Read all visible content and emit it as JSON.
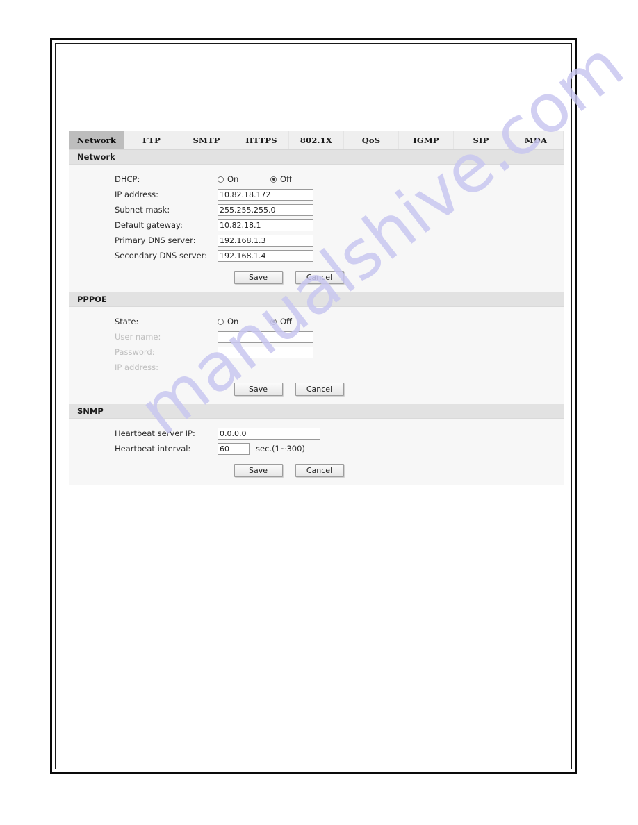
{
  "watermark": {
    "text": "manualshive.com",
    "color": "#c9c7f0"
  },
  "tabs": [
    {
      "label": "Network",
      "active": true
    },
    {
      "label": "FTP",
      "active": false
    },
    {
      "label": "SMTP",
      "active": false
    },
    {
      "label": "HTTPS",
      "active": false
    },
    {
      "label": "802.1X",
      "active": false
    },
    {
      "label": "QoS",
      "active": false
    },
    {
      "label": "IGMP",
      "active": false
    },
    {
      "label": "SIP",
      "active": false
    },
    {
      "label": "MDA",
      "active": false
    }
  ],
  "network": {
    "section_title": "Network",
    "dhcp": {
      "label": "DHCP:",
      "on_label": "On",
      "off_label": "Off",
      "selected": "Off"
    },
    "fields": [
      {
        "label": "IP address:",
        "value": "10.82.18.172"
      },
      {
        "label": "Subnet mask:",
        "value": "255.255.255.0"
      },
      {
        "label": "Default gateway:",
        "value": "10.82.18.1"
      },
      {
        "label": "Primary DNS server:",
        "value": "192.168.1.3"
      },
      {
        "label": "Secondary DNS server:",
        "value": "192.168.1.4"
      }
    ],
    "save_label": "Save",
    "cancel_label": "Cancel"
  },
  "pppoe": {
    "section_title": "PPPOE",
    "state": {
      "label": "State:",
      "on_label": "On",
      "off_label": "Off",
      "selected": "Off"
    },
    "username": {
      "label": "User name:",
      "value": "",
      "disabled": true
    },
    "password": {
      "label": "Password:",
      "value": "",
      "disabled": true
    },
    "ip_address": {
      "label": "IP address:",
      "value": "",
      "disabled": true
    },
    "save_label": "Save",
    "cancel_label": "Cancel"
  },
  "snmp": {
    "section_title": "SNMP",
    "heartbeat_server_ip": {
      "label": "Heartbeat server IP:",
      "value": "0.0.0.0"
    },
    "heartbeat_interval": {
      "label": "Heartbeat interval:",
      "value": "60",
      "suffix": "sec.(1~300)"
    },
    "save_label": "Save",
    "cancel_label": "Cancel"
  }
}
